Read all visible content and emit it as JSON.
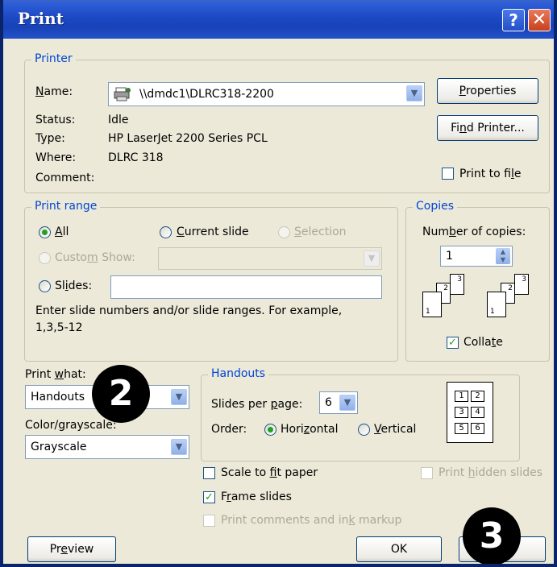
{
  "window": {
    "title": "Print",
    "help_label": "?",
    "close_label": "✕"
  },
  "printer": {
    "legend": "Printer",
    "name_label": "Name:",
    "name_value": "\\\\dmdc1\\DLRC318-2200",
    "status_label": "Status:",
    "status_value": "Idle",
    "type_label": "Type:",
    "type_value": "HP LaserJet 2200 Series PCL",
    "where_label": "Where:",
    "where_value": "DLRC 318",
    "comment_label": "Comment:",
    "properties_button": "Properties",
    "find_printer_button": "Find Printer...",
    "print_to_file_label": "Print to file",
    "print_to_file_checked": false
  },
  "print_range": {
    "legend": "Print range",
    "all_label": "All",
    "current_slide_label": "Current slide",
    "selection_label": "Selection",
    "custom_show_label": "Custom Show:",
    "slides_label": "Slides:",
    "slides_value": "",
    "help_text_line1": "Enter slide numbers and/or slide ranges. For example,",
    "help_text_line2": "1,3,5-12",
    "selected": "All"
  },
  "copies": {
    "legend": "Copies",
    "number_label": "Number of copies:",
    "number_value": "1",
    "collate_label": "Collate",
    "collate_checked": true,
    "page_numbers": [
      "1",
      "2",
      "3"
    ]
  },
  "print_what": {
    "label": "Print what:",
    "value": "Handouts",
    "color_label": "Color/grayscale:",
    "color_value": "Grayscale"
  },
  "handouts": {
    "legend": "Handouts",
    "slides_per_page_label": "Slides per page:",
    "slides_per_page_value": "6",
    "order_label": "Order:",
    "horizontal_label": "Horizontal",
    "vertical_label": "Vertical",
    "order_selected": "Horizontal",
    "preview_cells": [
      "1",
      "2",
      "3",
      "4",
      "5",
      "6"
    ]
  },
  "options": {
    "scale_to_fit_label": "Scale to fit paper",
    "scale_to_fit_checked": false,
    "frame_slides_label": "Frame slides",
    "frame_slides_checked": true,
    "print_comments_label": "Print comments and ink markup",
    "print_hidden_label": "Print hidden slides"
  },
  "buttons": {
    "preview": "Preview",
    "ok": "OK"
  },
  "callouts": {
    "two": "2",
    "three": "3"
  },
  "colors": {
    "title_bar": "#1c49c4",
    "legend_text": "#0046d5",
    "dialog_bg": "#ece9d8",
    "check_green": "#21a121"
  }
}
